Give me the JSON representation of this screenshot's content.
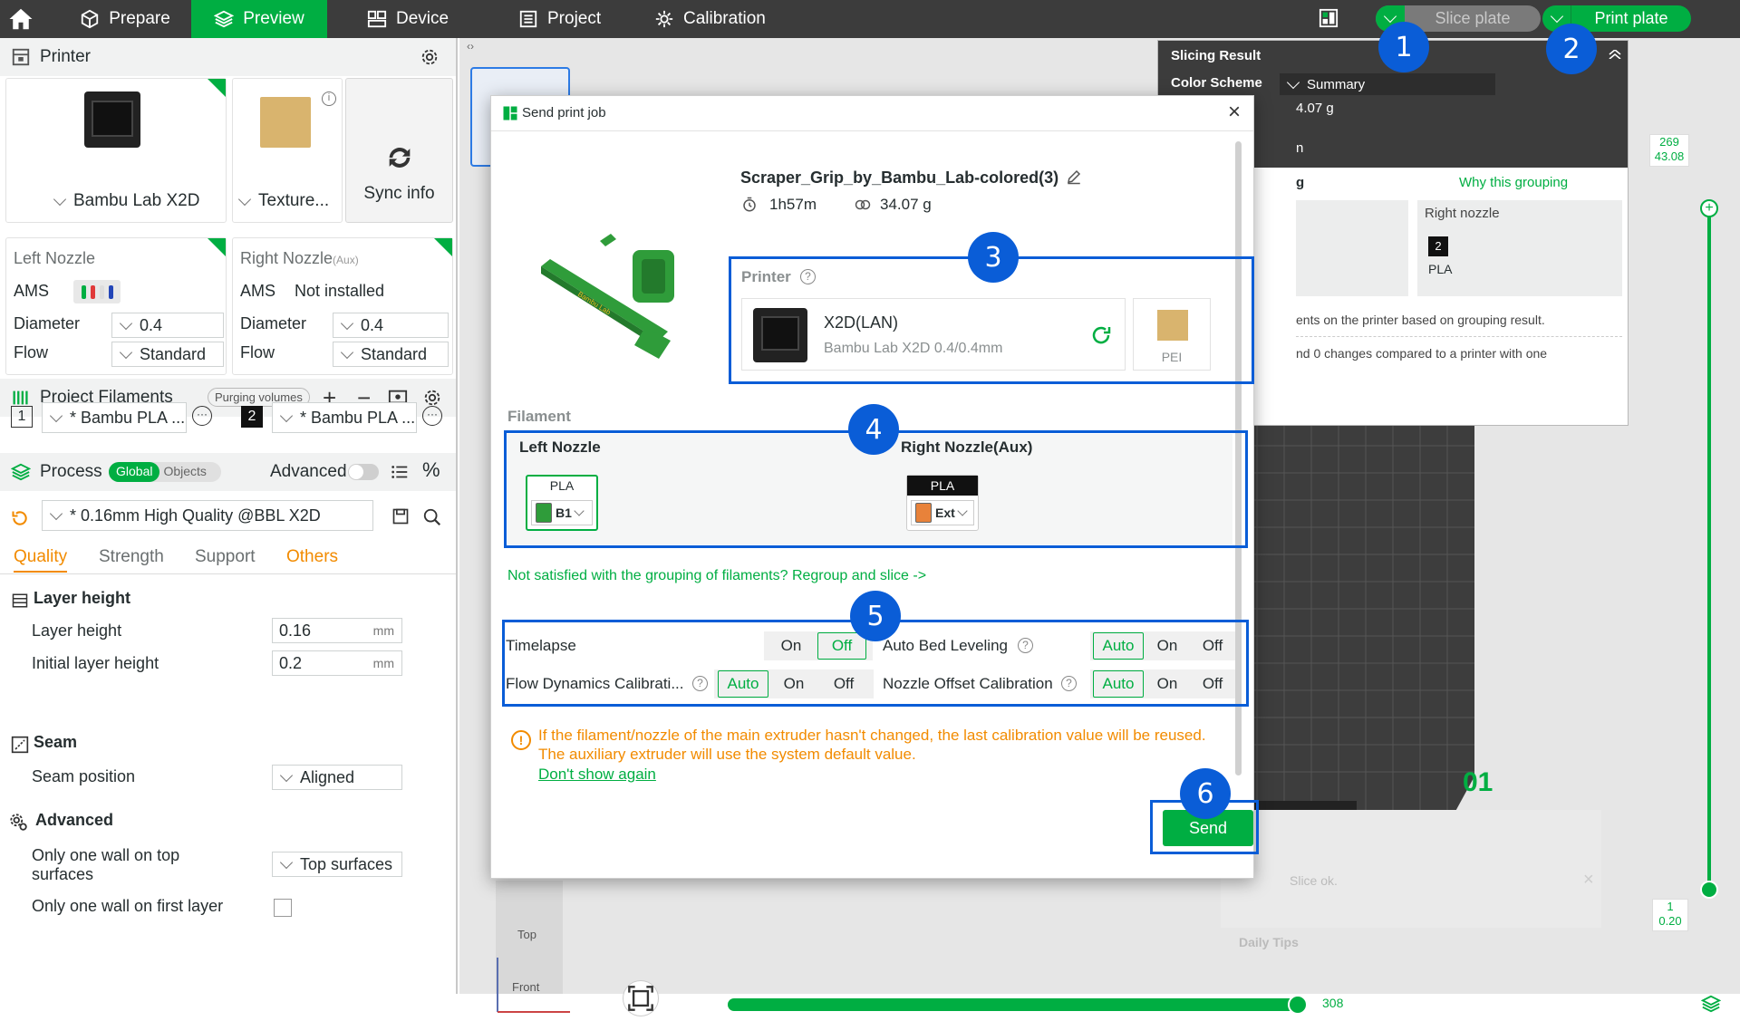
{
  "topbar": {
    "tabs": [
      {
        "label": "Prepare"
      },
      {
        "label": "Preview"
      },
      {
        "label": "Device"
      },
      {
        "label": "Project"
      },
      {
        "label": "Calibration"
      }
    ],
    "slice_plate": "Slice plate",
    "print_plate": "Print plate"
  },
  "printer": {
    "section_title": "Printer",
    "name": "Bambu Lab X2D",
    "plate": "Texture...",
    "sync": "Sync info",
    "left_nozzle": {
      "title": "Left Nozzle",
      "ams_label": "AMS",
      "diameter_label": "Diameter",
      "diameter": "0.4",
      "flow_label": "Flow",
      "flow": "Standard"
    },
    "right_nozzle": {
      "title": "Right Nozzle",
      "title_sub": "(Aux)",
      "ams_label": "AMS",
      "ams_value": "Not installed",
      "diameter_label": "Diameter",
      "diameter": "0.4",
      "flow_label": "Flow",
      "flow": "Standard"
    }
  },
  "filaments": {
    "title": "Project Filaments",
    "purging": "Purging volumes",
    "items": [
      {
        "index": "1",
        "name": "* Bambu PLA ..."
      },
      {
        "index": "2",
        "name": "* Bambu PLA ..."
      }
    ]
  },
  "process": {
    "title": "Process",
    "toggle_global": "Global",
    "toggle_objects": "Objects",
    "advanced": "Advanced",
    "preset": "* 0.16mm High Quality @BBL X2D",
    "tabs": [
      "Quality",
      "Strength",
      "Support",
      "Others"
    ],
    "groups": {
      "layer_height": "Layer height",
      "seam": "Seam",
      "advanced": "Advanced"
    },
    "layer_height_label": "Layer height",
    "layer_height": "0.16",
    "initial_layer_label": "Initial layer height",
    "initial_layer": "0.2",
    "unit": "mm",
    "seam_position_label": "Seam position",
    "seam_position": "Aligned",
    "one_wall_top_label": "Only one wall on top surfaces",
    "one_wall_top": "Top surfaces",
    "one_wall_first_label": "Only one wall on first layer"
  },
  "slicing_result": {
    "title": "Slicing Result",
    "color_scheme_label": "Color Scheme",
    "color_scheme": "Summary",
    "weight_partial": "4.07 g",
    "letter_n": "n",
    "letter_g": "g",
    "why_grouping": "Why this grouping",
    "right_nozzle": "Right nozzle",
    "filament_index": "2",
    "filament_type": "PLA",
    "note1": "ents on the printer based on grouping result.",
    "note2": "nd 0 changes compared to a printer with one"
  },
  "viewport": {
    "top_label": "Top",
    "front_label": "Front",
    "plate_number": "01",
    "layer_top": "269",
    "height_top": "43.08",
    "layer_bottom": "1",
    "height_bottom": "0.20",
    "move_value": "308",
    "slice_ok": "Slice ok.",
    "daily_tips": "Daily Tips"
  },
  "dialog": {
    "title": "Send print job",
    "file_name": "Scraper_Grip_by_Bambu_Lab-colored(3)",
    "time": "1h57m",
    "weight": "34.07 g",
    "printer_label": "Printer",
    "printer_name": "X2D(LAN)",
    "printer_model": "Bambu Lab X2D  0.4/0.4mm",
    "plate_type": "PEI",
    "filament_label": "Filament",
    "left_nozzle": "Left Nozzle",
    "right_nozzle": "Right Nozzle(Aux)",
    "left_material": "PLA",
    "left_slot": "B1",
    "right_material": "PLA",
    "right_slot": "Ext",
    "regroup_text": "Not satisfied with the grouping of filaments? Regroup and slice ->",
    "options": {
      "timelapse": "Timelapse",
      "auto_bed": "Auto Bed Leveling",
      "flow_cal": "Flow Dynamics Calibrati...",
      "nozzle_offset": "Nozzle Offset Calibration",
      "auto": "Auto",
      "on": "On",
      "off": "Off"
    },
    "warning": "If the filament/nozzle of the main extruder hasn't changed, the last calibration value will be reused. The auxiliary extruder will use the system default value.",
    "dont_show": "Don't show again",
    "send": "Send"
  },
  "annotations": [
    "1",
    "2",
    "3",
    "4",
    "5",
    "6"
  ],
  "colors": {
    "accent": "#00ae42",
    "annotation": "#0a5dd7",
    "warning": "#f28b00"
  }
}
